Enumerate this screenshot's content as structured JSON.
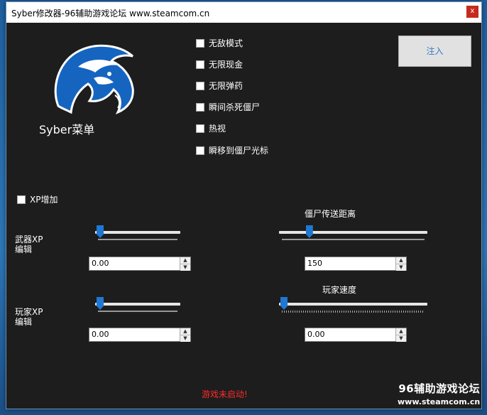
{
  "window": {
    "title": "Syber修改器-96辅助游戏论坛 www.steamcom.cn",
    "close_label": "x"
  },
  "logo": {
    "caption": "Syber菜单",
    "primary_color": "#1565c0",
    "accent_color": "#ffffff"
  },
  "cheats": [
    {
      "label": "无敌模式",
      "checked": false
    },
    {
      "label": "无限现金",
      "checked": false
    },
    {
      "label": "无限弹药",
      "checked": false
    },
    {
      "label": "瞬间杀死僵尸",
      "checked": false
    },
    {
      "label": "热视",
      "checked": false
    },
    {
      "label": "瞬移到僵尸光标",
      "checked": false
    }
  ],
  "inject_button": "注入",
  "xp": {
    "add_label": "XP增加",
    "add_checked": false
  },
  "weapon_xp": {
    "label_line1": "武器XP",
    "label_line2": "编辑",
    "value": "0.00",
    "slider_fraction": 0.0
  },
  "player_xp": {
    "label_line1": "玩家XP",
    "label_line2": "编辑",
    "value": "0.00",
    "slider_fraction": 0.0
  },
  "zombie_distance": {
    "label": "僵尸传送距离",
    "value": "150",
    "slider_fraction": 0.18
  },
  "player_speed": {
    "label": "玩家速度",
    "value": "0.00",
    "slider_fraction": 0.0
  },
  "status": {
    "text": "游戏未启动!",
    "color": "#ff2a2a"
  },
  "watermark": {
    "line1": "96辅助游戏论坛",
    "line2": "www.steamcom.cn"
  }
}
